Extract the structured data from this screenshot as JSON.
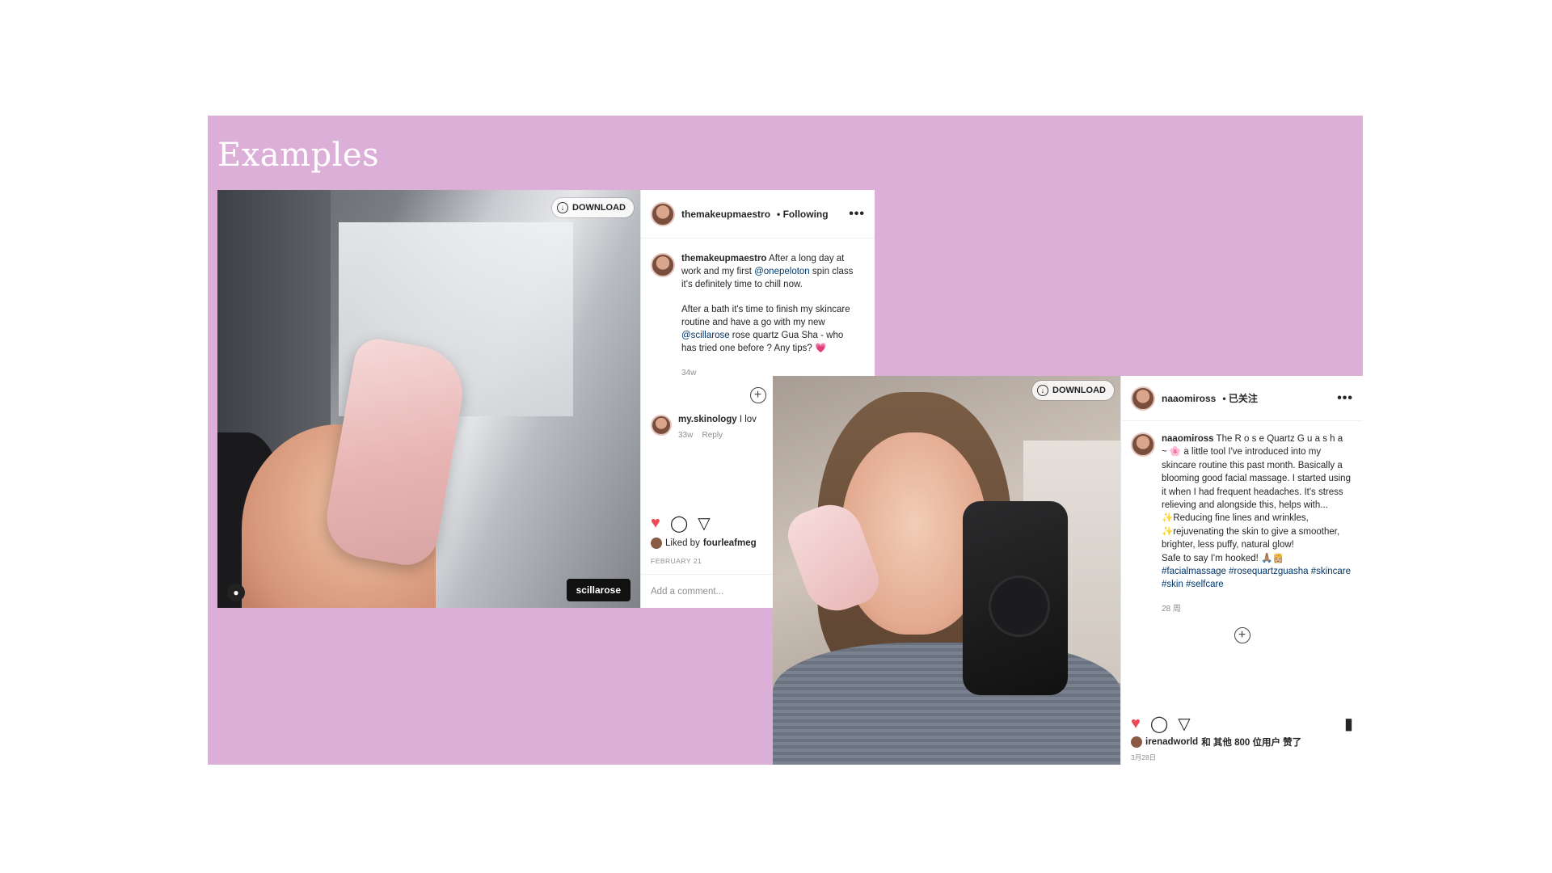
{
  "slide": {
    "title": "Examples",
    "background": "#dcafd8"
  },
  "post1": {
    "download_label": "DOWNLOAD",
    "tag_label": "scillarose",
    "header": {
      "username": "themakeupmaestro",
      "follow_status": "• Following",
      "more": "•••"
    },
    "caption": {
      "username": "themakeupmaestro",
      "part1": " After a long day at work and my first ",
      "mention1": "@onepeloton",
      "part2": " spin class it's definitely time to chill now.",
      "part3": "After a bath it's time to finish my skincare routine and have a go with my new ",
      "mention2": "@scillarose",
      "part4": " rose quartz Gua Sha - who has tried one before ? Any tips? 💗",
      "time": "34w"
    },
    "comment": {
      "username": "my.skinology",
      "text": " I lov",
      "time": "33w",
      "reply": "Reply"
    },
    "likes": {
      "prefix": "Liked by ",
      "user": "fourleafmeg"
    },
    "date": "FEBRUARY 21",
    "add_comment_placeholder": "Add a comment..."
  },
  "post2": {
    "download_label": "DOWNLOAD",
    "header": {
      "username": "naaomiross",
      "follow_status": "• 已关注",
      "more": "•••"
    },
    "caption": {
      "username": "naaomiross",
      "text1": " The R o s e Quartz G u a s h a ~ 🌸 a little tool I've introduced into my skincare routine this past month. Basically a blooming good facial massage. I started using it when I had frequent headaches. It's stress relieving and alongside this, helps with...",
      "line2": "✨Reducing fine lines and wrinkles,",
      "line3": "✨rejuvenating the skin to give a smoother, brighter, less puffy, natural glow!",
      "line4": "Safe to say I'm hooked! 🙏🏽👸🏼",
      "hashtags": "#facialmassage #rosequartzguasha #skincare #skin #selfcare",
      "time": "28 周"
    },
    "likes": {
      "user": "irenadworld",
      "suffix": " 和 其他 800 位用户 赞了"
    },
    "date": "3月28日"
  },
  "colors": {
    "like_red": "#ed4956",
    "mention_blue": "#00376b",
    "muted_gray": "#8e8e8e"
  },
  "icons": [
    "download-icon",
    "user-tag-icon",
    "more-icon",
    "add-circle-icon",
    "heart-icon",
    "comment-icon",
    "send-icon",
    "bookmark-icon"
  ]
}
